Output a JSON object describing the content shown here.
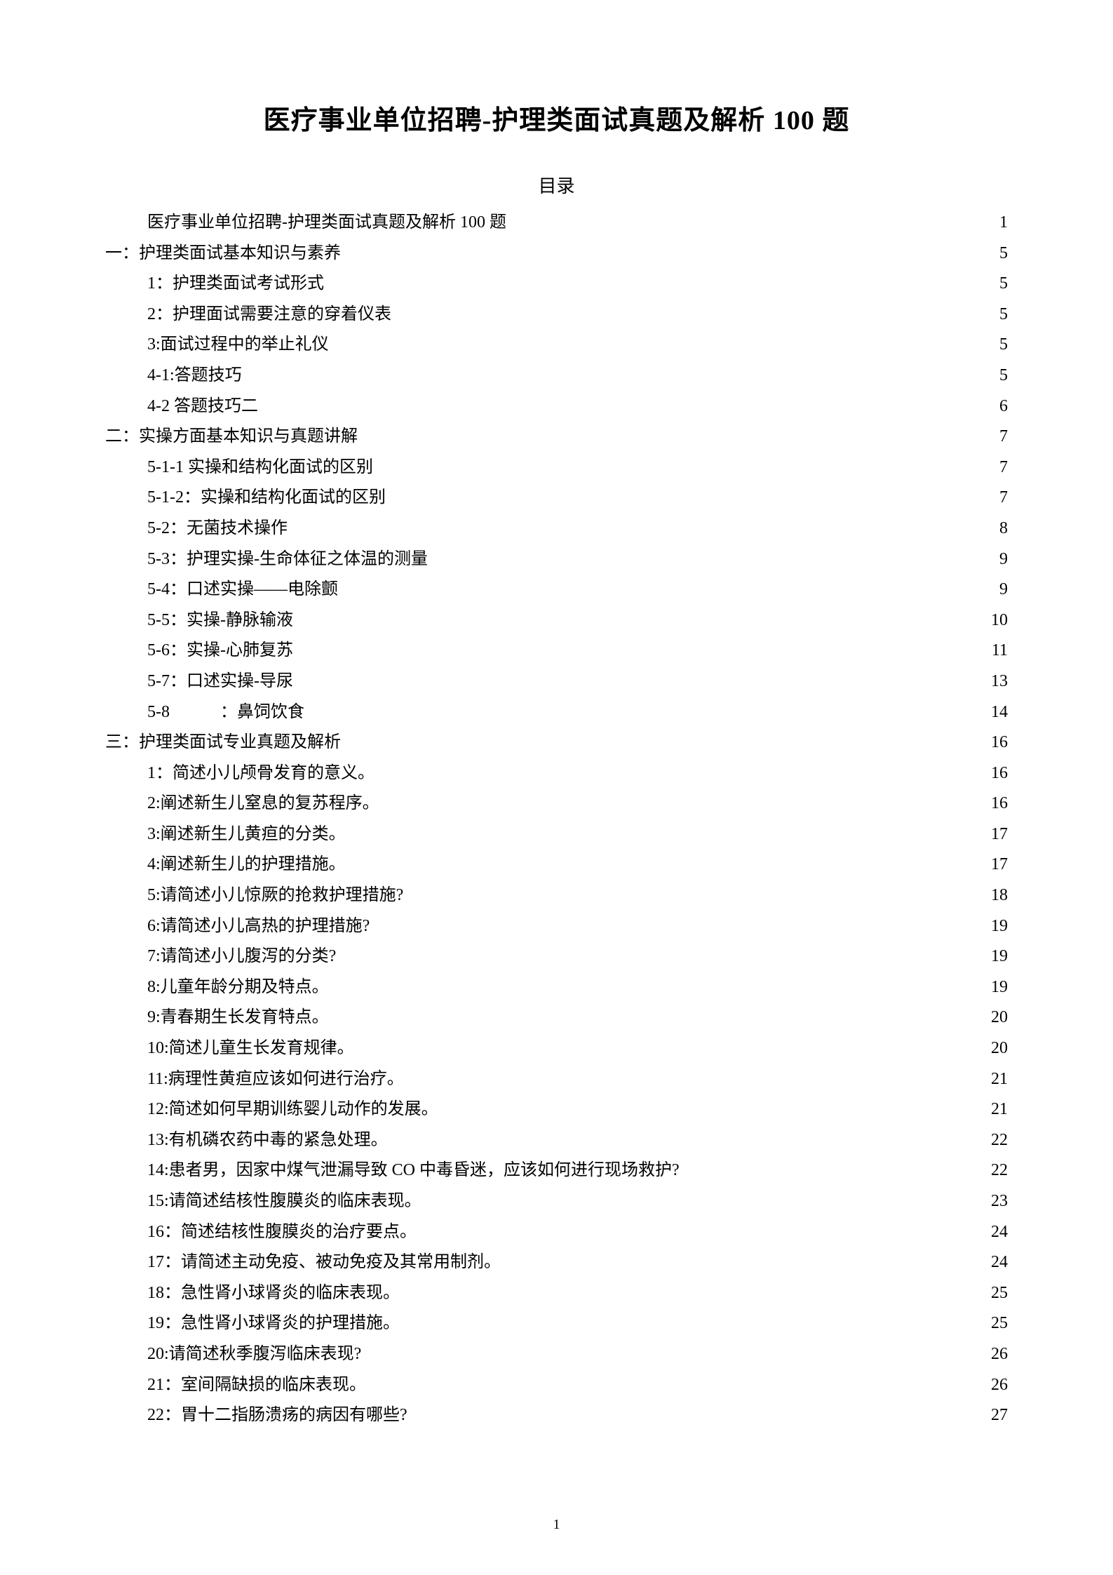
{
  "title": "医疗事业单位招聘-护理类面试真题及解析 100 题",
  "toc_heading": "目录",
  "page_number": "1",
  "toc": [
    {
      "indent": 1,
      "label": "医疗事业单位招聘-护理类面试真题及解析 100 题",
      "page": "1"
    },
    {
      "indent": 0,
      "label": "一：护理类面试基本知识与素养",
      "page": "5"
    },
    {
      "indent": 1,
      "label": "1：护理类面试考试形式",
      "page": "5"
    },
    {
      "indent": 1,
      "label": "2：护理面试需要注意的穿着仪表",
      "page": "5"
    },
    {
      "indent": 1,
      "label": "3:面试过程中的举止礼仪",
      "page": "5"
    },
    {
      "indent": 1,
      "label": "4-1:答题技巧",
      "page": "5"
    },
    {
      "indent": 1,
      "label": "4-2 答题技巧二",
      "page": "6"
    },
    {
      "indent": 0,
      "label": "二：实操方面基本知识与真题讲解 ",
      "page": "7"
    },
    {
      "indent": 1,
      "label": "5-1-1 实操和结构化面试的区别",
      "page": "7"
    },
    {
      "indent": 1,
      "label": "5-1-2：实操和结构化面试的区别",
      "page": "7"
    },
    {
      "indent": 1,
      "label": "5-2：无菌技术操作",
      "page": "8"
    },
    {
      "indent": 1,
      "label": "5-3：护理实操-生命体征之体温的测量",
      "page": "9"
    },
    {
      "indent": 1,
      "label": "5-4：口述实操——电除颤",
      "page": "9"
    },
    {
      "indent": 1,
      "label": "5-5：实操-静脉输液 ",
      "page": "10"
    },
    {
      "indent": 1,
      "label": "5-6：实操-心肺复苏",
      "page": "11"
    },
    {
      "indent": 1,
      "label": "5-7：口述实操-导尿",
      "page": "13"
    },
    {
      "indent": 1,
      "label": "5-8   ：鼻饲饮食",
      "page": "14"
    },
    {
      "indent": 0,
      "label": "三：护理类面试专业真题及解析",
      "page": "16"
    },
    {
      "indent": 1,
      "label": "1：简述小儿颅骨发育的意义。",
      "page": "16"
    },
    {
      "indent": 1,
      "label": "2:阐述新生儿窒息的复苏程序。",
      "page": "16"
    },
    {
      "indent": 1,
      "label": "3:阐述新生儿黄疸的分类。",
      "page": "17"
    },
    {
      "indent": 1,
      "label": "4:阐述新生儿的护理措施。",
      "page": "17"
    },
    {
      "indent": 1,
      "label": "5:请简述小儿惊厥的抢救护理措施?",
      "page": "18"
    },
    {
      "indent": 1,
      "label": "6:请简述小儿高热的护理措施?",
      "page": "19"
    },
    {
      "indent": 1,
      "label": "7:请简述小儿腹泻的分类?",
      "page": "19"
    },
    {
      "indent": 1,
      "label": "8:儿童年龄分期及特点。",
      "page": "19"
    },
    {
      "indent": 1,
      "label": "9:青春期生长发育特点。",
      "page": "20"
    },
    {
      "indent": 1,
      "label": "10:简述儿童生长发育规律。",
      "page": "20"
    },
    {
      "indent": 1,
      "label": "11:病理性黄疸应该如何进行治疗。",
      "page": "21"
    },
    {
      "indent": 1,
      "label": "12:简述如何早期训练婴儿动作的发展。",
      "page": "21"
    },
    {
      "indent": 1,
      "label": "13:有机磷农药中毒的紧急处理。",
      "page": "22"
    },
    {
      "indent": 1,
      "label": "14:患者男，因家中煤气泄漏导致 CO 中毒昏迷，应该如何进行现场救护?",
      "page": "22"
    },
    {
      "indent": 1,
      "label": "15:请简述结核性腹膜炎的临床表现。",
      "page": "23"
    },
    {
      "indent": 1,
      "label": "16：简述结核性腹膜炎的治疗要点。",
      "page": "24"
    },
    {
      "indent": 1,
      "label": "17：请简述主动免疫、被动免疫及其常用制剂。",
      "page": "24"
    },
    {
      "indent": 1,
      "label": "18：急性肾小球肾炎的临床表现。",
      "page": "25"
    },
    {
      "indent": 1,
      "label": "19：急性肾小球肾炎的护理措施。",
      "page": "25"
    },
    {
      "indent": 1,
      "label": "20:请简述秋季腹泻临床表现?",
      "page": "26"
    },
    {
      "indent": 1,
      "label": "21：室间隔缺损的临床表现。",
      "page": "26"
    },
    {
      "indent": 1,
      "label": "22：胃十二指肠溃疡的病因有哪些?",
      "page": "27"
    }
  ]
}
